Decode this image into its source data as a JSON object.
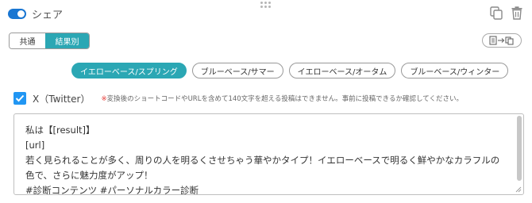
{
  "header": {
    "title": "シェア",
    "toggle_on": true
  },
  "top_icons": [
    "copy-icon",
    "trash-icon"
  ],
  "segments": [
    {
      "label": "共通",
      "active": false
    },
    {
      "label": "結果別",
      "active": true
    }
  ],
  "import_button_icon": "copy-from-icon",
  "tabs": [
    {
      "label": "イエローベース/スプリング",
      "active": true
    },
    {
      "label": "ブルーベース/サマー",
      "active": false
    },
    {
      "label": "イエローベース/オータム",
      "active": false
    },
    {
      "label": "ブルーベース/ウィンター",
      "active": false
    }
  ],
  "sns": {
    "checked": true,
    "label": "X（Twitter）",
    "note_mark": "※",
    "note": "変換後のショートコードやURLを含めて140文字を超える投稿はできません。事前に投稿できるか確認してください。"
  },
  "share_text": "私は【[result]】\n[url]\n若く見られることが多く、周りの人を明るくさせちゃう華やかタイプ！イエローベースで明るく鮮やかなカラフルの色で、さらに魅力度がアップ！\n#診断コンテンツ #パーソナルカラー診断",
  "colors": {
    "accent": "#2ba7b4",
    "toggle": "#1976d2",
    "checkbox": "#2196f3",
    "note_mark": "#e53935"
  }
}
